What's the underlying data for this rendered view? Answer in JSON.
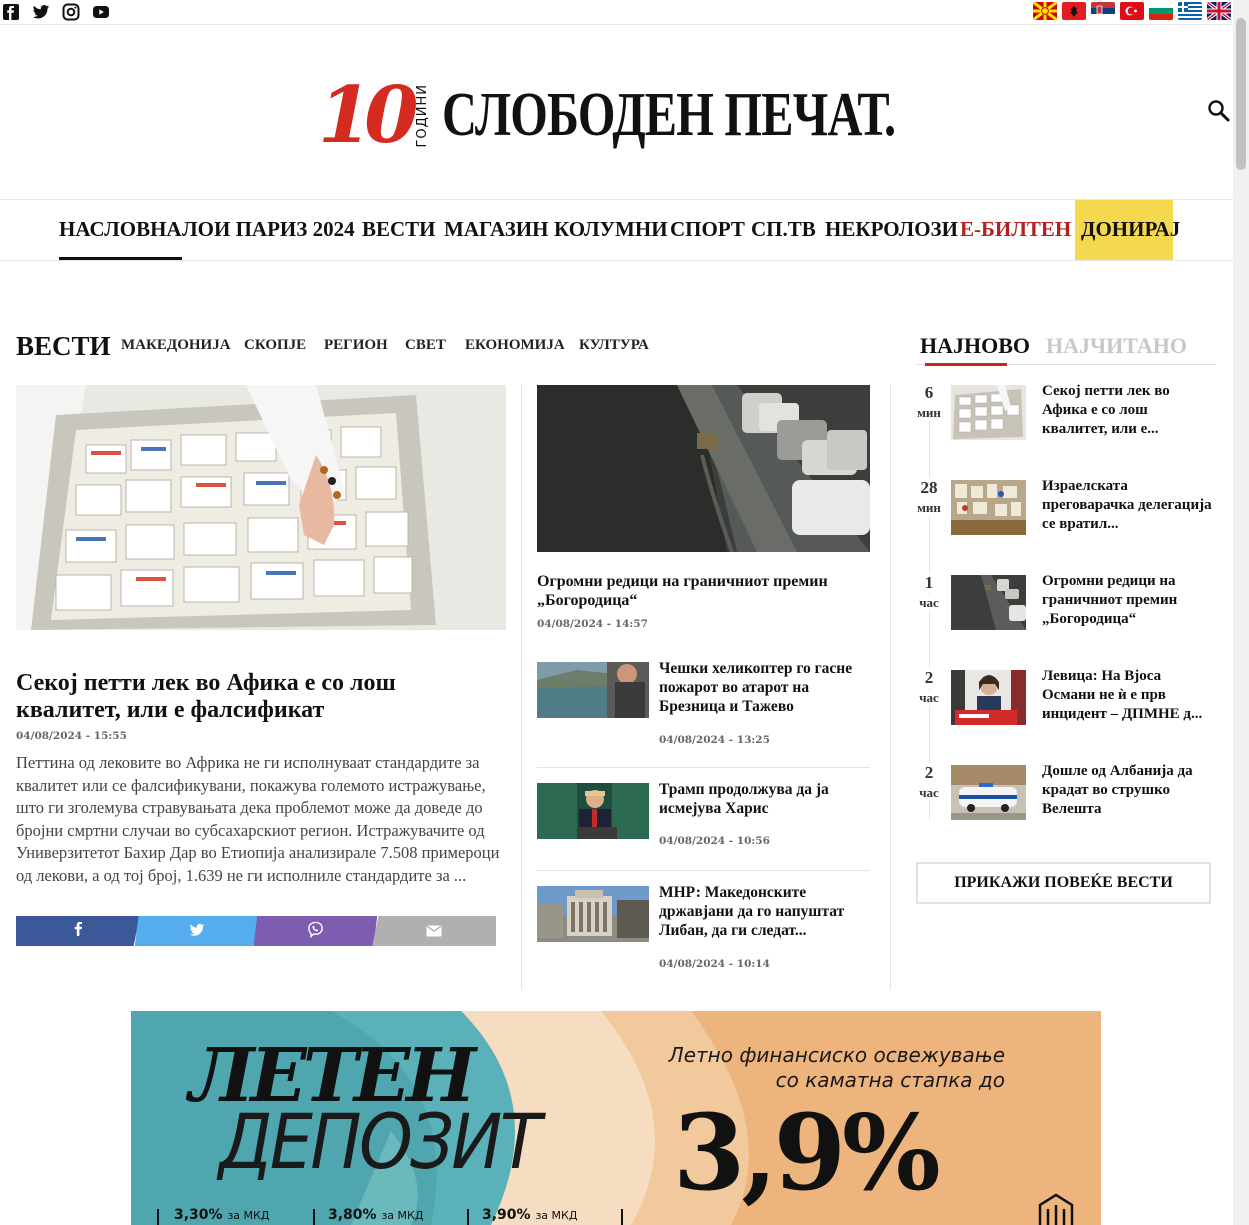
{
  "topbar": {
    "social": [
      "facebook-icon",
      "twitter-icon",
      "instagram-icon",
      "youtube-icon"
    ],
    "languages": [
      "mk",
      "al",
      "rs",
      "tr",
      "bg",
      "gr",
      "gb"
    ]
  },
  "logo": {
    "years_number": "10",
    "years_word": "ГОДИНИ",
    "name": "СЛОБОДЕН ПЕЧАТ."
  },
  "nav": {
    "items": [
      "НАСЛОВНА",
      "ЛОИ ПАРИЗ 2024",
      "ВЕСТИ",
      "МАГАЗИН",
      "КОЛУМНИ",
      "СПОРТ",
      "СП.ТВ",
      "НЕКРОЛОЗИ",
      "Е-БИЛТЕН",
      "ДОНИРАЈ"
    ],
    "active": "НАСЛОВНА"
  },
  "section": {
    "title": "ВЕСТИ",
    "subnav": [
      "МАКЕДОНИЈА",
      "СКОПЈЕ",
      "РЕГИОН",
      "СВЕТ",
      "ЕКОНОМИЈА",
      "КУЛТУРА"
    ]
  },
  "lead": {
    "title": "Секој петти лек во Афика е со лош квалитет, или е фалсификат",
    "date": "04/08/2024 - 15:55",
    "excerpt": "Петтина од лековите во Африка не ги исполнуваат стандардите за квалитет или се фалсификувани, покажува големото истражување, што ги зголемува стравувањата дека проблемот може да доведе до бројни смртни случаи во субсахарскиот регион. Истражувачите од Универзитетот Бахир Дар во Етиопија анализирале 7.508 примероци од лекови, а од тој број, 1.639 не ги исполниле стандардите за ..."
  },
  "share": {
    "buttons": [
      "facebook-icon",
      "twitter-icon",
      "viber-icon",
      "email-icon"
    ],
    "colors": [
      "#3b5998",
      "#55acee",
      "#7d5db0",
      "#b0b0b0"
    ]
  },
  "middle": {
    "top": {
      "title": "Огромни редици на граничниот премин „Богородица“",
      "date": "04/08/2024 - 14:57"
    },
    "list": [
      {
        "title": "Чешки хеликоптер го гасне пожарот во атарот на Брезница и Тажево",
        "date": "04/08/2024 - 13:25"
      },
      {
        "title": "Трамп продолжува да ја исмејува Харис",
        "date": "04/08/2024 - 10:56"
      },
      {
        "title": "МНР: Македонските државјани да го напуштат Либан, да ги следат...",
        "date": "04/08/2024 - 10:14"
      }
    ]
  },
  "sidebar": {
    "tabs": [
      "НАЈНОВО",
      "НАЈЧИТАНО"
    ],
    "active_tab": "НАЈНОВО",
    "items": [
      {
        "num": "6",
        "unit": "мин",
        "title": "Секој петти лек во Афика е со лош квалитет, или е..."
      },
      {
        "num": "28",
        "unit": "мин",
        "title": "Израелската преговарачка делегација се вратил..."
      },
      {
        "num": "1",
        "unit": "час",
        "title": "Огромни редици на граничниот премин „Богородица“"
      },
      {
        "num": "2",
        "unit": "час",
        "title": "Левица: На Вјоса Османи не ѝ е прв инцидент – ДПМНЕ д..."
      },
      {
        "num": "2",
        "unit": "час",
        "title": "Дошле од Албанија да крадат во струшко Велешта"
      }
    ],
    "more_button": "ПРИКАЖИ ПОВЕЌЕ ВЕСТИ"
  },
  "banner": {
    "line1": "ЛЕТЕН",
    "line2": "ДЕПОЗИТ",
    "tagline_1": "Летно финансиско освежување",
    "tagline_2": "со каматна стапка до",
    "rate": "3,9%",
    "rates": [
      {
        "value": "3,30%",
        "currency": "за МКД"
      },
      {
        "value": "3,80%",
        "currency": "за МКД"
      },
      {
        "value": "3,90%",
        "currency": "за МКД"
      }
    ]
  }
}
